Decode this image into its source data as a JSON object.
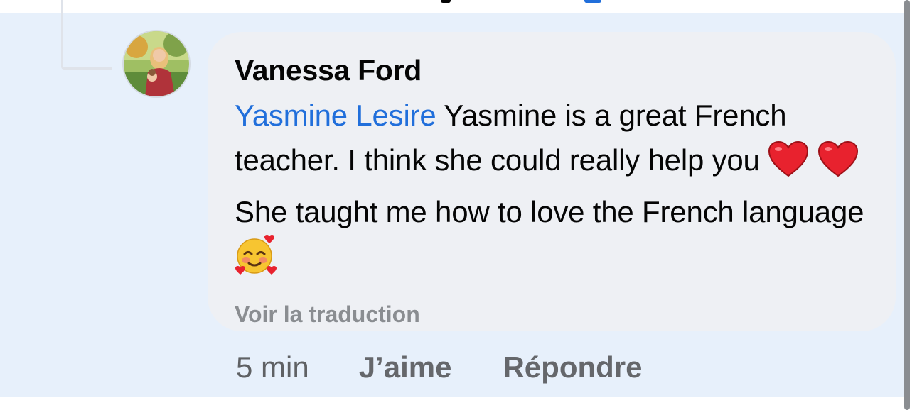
{
  "comment": {
    "author": "Vanessa Ford",
    "mention": "Yasmine Lesire",
    "text_part1": " Yasmine is a great French teacher. I think she could really help you ",
    "text_part2": " She taught me how to love the French language ",
    "translate_label": "Voir la traduction"
  },
  "actions": {
    "time": "5 min",
    "like_label": "J’aime",
    "reply_label": "Répondre"
  },
  "icons": {
    "avatar": "profile-photo",
    "emoji_1": "red-heart",
    "emoji_2": "red-heart",
    "emoji_3": "smiling-face-with-hearts"
  },
  "colors": {
    "highlight_background": "#e7f0fb",
    "bubble": "#eef0f4",
    "mention": "#216fdb",
    "secondary_text": "#65676b"
  }
}
